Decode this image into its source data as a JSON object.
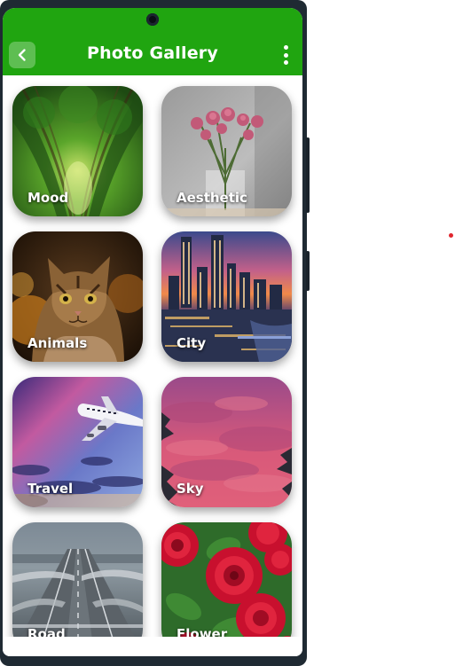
{
  "app": {
    "title": "Photo Gallery",
    "accent_color": "#20a510",
    "back_icon": "chevron-left-icon",
    "menu_icon": "more-vertical-icon"
  },
  "gallery": {
    "items": [
      {
        "label": "Mood"
      },
      {
        "label": "Aesthetic"
      },
      {
        "label": "Animals"
      },
      {
        "label": "City"
      },
      {
        "label": "Travel"
      },
      {
        "label": "Sky"
      },
      {
        "label": "Road"
      },
      {
        "label": "Flower"
      }
    ]
  }
}
